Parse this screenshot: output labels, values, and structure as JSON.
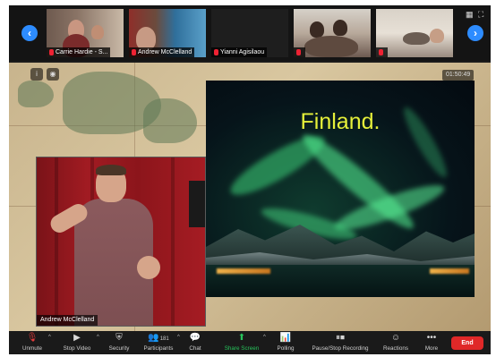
{
  "participants": [
    {
      "name": "Carrie Hardie - S..."
    },
    {
      "name": "Andrew McClelland"
    },
    {
      "name": "Yianni Agisilaou"
    },
    {
      "name": ""
    },
    {
      "name": ""
    }
  ],
  "share": {
    "timer": "01:50:49",
    "slide_title": "Finland."
  },
  "presenter": {
    "name": "Andrew McClelland"
  },
  "toolbar": {
    "unmute": "Unmute",
    "stop_video": "Stop Video",
    "security": "Security",
    "participants": "Participants",
    "participants_count": "181",
    "chat": "Chat",
    "share_screen": "Share Screen",
    "polling": "Polling",
    "pause_stop_recording": "Pause/Stop Recording",
    "reactions": "Reactions",
    "more": "More",
    "end": "End"
  },
  "icons": {
    "nav_prev": "chevron-left-icon",
    "nav_next": "chevron-right-icon",
    "grid": "grid-view-icon",
    "fullscreen": "fullscreen-icon",
    "mic_muted": "mic-muted-icon",
    "video": "video-camera-icon",
    "shield": "shield-icon",
    "participants": "people-icon",
    "chat": "chat-bubble-icon",
    "share": "share-screen-icon",
    "polling": "bar-chart-icon",
    "recording": "pause-stop-icon",
    "reactions": "emoji-icon",
    "more": "ellipsis-icon"
  },
  "colors": {
    "accent_blue": "#2d8cff",
    "end_red": "#e02828",
    "share_green": "#27c25b",
    "slide_title": "#e6f03a"
  }
}
